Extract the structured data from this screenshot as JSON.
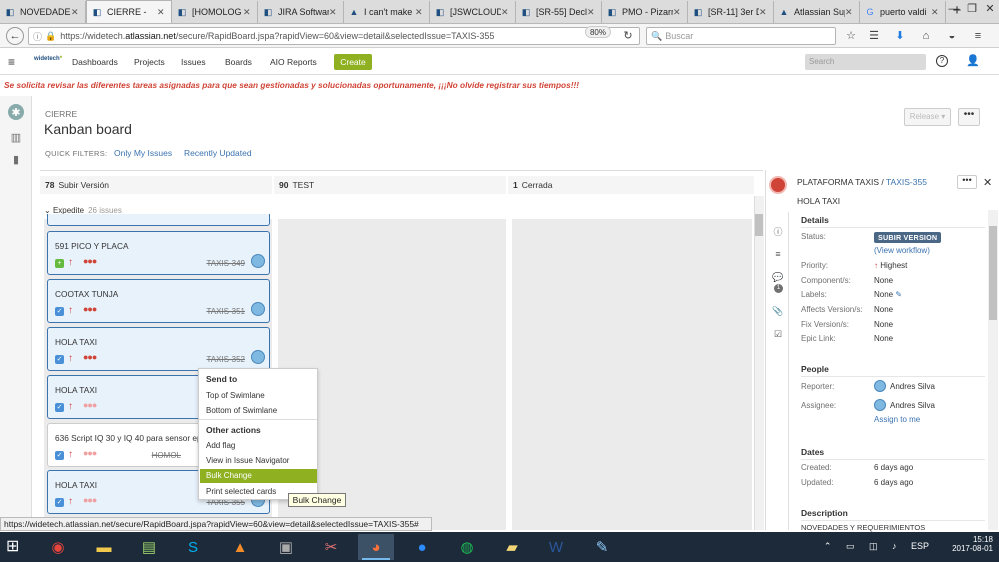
{
  "browser": {
    "tabs": [
      {
        "label": "NOVEDADES",
        "icon": "jira-icon",
        "active": false
      },
      {
        "label": "CIERRE -",
        "icon": "jira-icon",
        "active": true
      },
      {
        "label": "[HOMOLOG",
        "icon": "jira-icon",
        "active": false
      },
      {
        "label": "JIRA Softwar",
        "icon": "jira-icon",
        "active": false
      },
      {
        "label": "I can't make",
        "icon": "atlassian-icon",
        "active": false
      },
      {
        "label": "[JSWCLOUD",
        "icon": "jira-icon",
        "active": false
      },
      {
        "label": "[SR-55] Decl",
        "icon": "jira-icon",
        "active": false
      },
      {
        "label": "PMO - Pizarr",
        "icon": "jira-icon",
        "active": false
      },
      {
        "label": "[SR-11] 3er D",
        "icon": "jira-icon",
        "active": false
      },
      {
        "label": "Atlassian Suppo",
        "icon": "atlassian-icon",
        "active": false
      },
      {
        "label": "puerto valdi",
        "icon": "google-icon",
        "active": false
      }
    ],
    "url_prefix": "https://widetech.",
    "url_host": "atlassian.net",
    "url_rest": "/secure/RapidBoard.jspa?rapidView=60&view=detail&selectedIssue=TAXIS-355",
    "zoom": "80%",
    "search_placeholder": "Buscar",
    "status_url": "https://widetech.atlassian.net/secure/RapidBoard.jspa?rapidView=60&view=detail&selectedIssue=TAXIS-355#"
  },
  "jira": {
    "logo": "widetech",
    "menu": [
      "Dashboards",
      "Projects",
      "Issues",
      "Boards",
      "AIO Reports"
    ],
    "create": "Create",
    "search_placeholder": "Search",
    "notice": "Se solicita revisar las diferentes tareas asignadas para que sean gestionadas y solucionadas oportunamente, ¡¡¡No olvide registrar sus tiempos!!!"
  },
  "board": {
    "project": "CIERRE",
    "title": "Kanban board",
    "quick_filters_label": "QUICK FILTERS:",
    "quick_filters": [
      "Only My Issues",
      "Recently Updated"
    ],
    "release": "Release ▾",
    "more": "•••",
    "columns": [
      {
        "count": "78",
        "name": "Subir Versión"
      },
      {
        "count": "90",
        "name": "TEST"
      },
      {
        "count": "1",
        "name": "Cerrada"
      }
    ],
    "swimlane": {
      "name": "Expedite",
      "count": "26 issues"
    },
    "cards": [
      {
        "title": "591 PICO Y PLACA",
        "type": "story",
        "key": "TAXIS-349"
      },
      {
        "title": "COOTAX TUNJA",
        "type": "task",
        "key": "TAXIS-351"
      },
      {
        "title": "HOLA TAXI",
        "type": "task",
        "key": "TAXIS-352"
      },
      {
        "title": "HOLA TAXI",
        "type": "task",
        "key": ""
      },
      {
        "title": "636 Script IQ 30 y IQ 40 para sensor eps",
        "type": "task",
        "key": "HOMOL"
      },
      {
        "title": "HOLA TAXI",
        "type": "task",
        "key": "TAXIS-355"
      }
    ]
  },
  "context_menu": {
    "send_to": "Send to",
    "top": "Top of Swimlane",
    "bottom": "Bottom of Swimlane",
    "other": "Other actions",
    "add_flag": "Add flag",
    "view_nav": "View in Issue Navigator",
    "bulk": "Bulk Change",
    "print": "Print selected cards",
    "tooltip": "Bulk Change"
  },
  "detail": {
    "project": "PLATAFORMA TAXIS /",
    "key": "TAXIS-355",
    "summary": "HOLA TAXI",
    "details_h": "Details",
    "status_l": "Status:",
    "status": "SUBIR VERSION",
    "workflow": "(View workflow)",
    "priority_l": "Priority:",
    "priority": "Highest",
    "components_l": "Component/s:",
    "components": "None",
    "labels_l": "Labels:",
    "labels": "None",
    "affects_l": "Affects Version/s:",
    "affects": "None",
    "fix_l": "Fix Version/s:",
    "fix": "None",
    "epic_l": "Epic Link:",
    "epic": "None",
    "people_h": "People",
    "reporter_l": "Reporter:",
    "reporter": "Andres Silva",
    "assignee_l": "Assignee:",
    "assignee": "Andres Silva",
    "assign_me": "Assign to me",
    "dates_h": "Dates",
    "created_l": "Created:",
    "created": "6 days ago",
    "updated_l": "Updated:",
    "updated": "6 days ago",
    "desc_h": "Description",
    "desc": "NOVEDADES Y REQUERIMIENTOS",
    "comment_count": "1"
  },
  "taskbar": {
    "lang": "ESP",
    "time": "15:18",
    "date": "2017-08-01"
  },
  "colors": {
    "jira_blue": "#3b73af",
    "create_green": "#8eb021",
    "notice_red": "#d04437",
    "status_badge": "#4a6785"
  }
}
